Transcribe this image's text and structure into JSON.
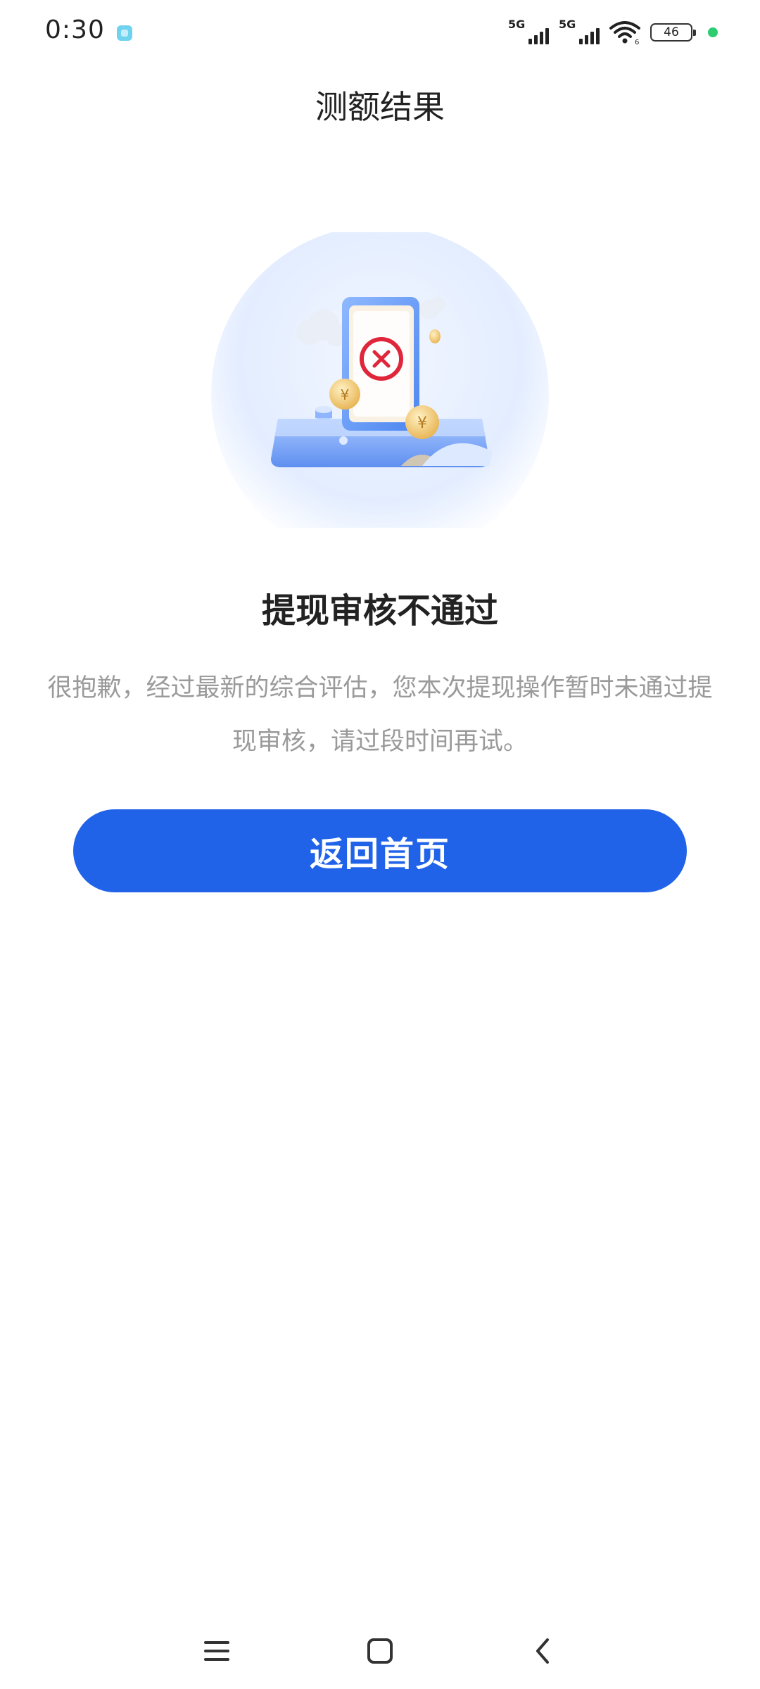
{
  "status_bar": {
    "time": "0:30",
    "signal_1_label": "5G",
    "signal_2_label": "5G",
    "battery": "46",
    "wifi_sub": "6"
  },
  "header": {
    "title": "测额结果"
  },
  "result": {
    "title": "提现审核不通过",
    "description": "很抱歉，经过最新的综合评估，您本次提现操作暂时未通过提现审核，请过段时间再试。"
  },
  "actions": {
    "home_label": "返回首页"
  },
  "icons": {
    "status_indicator": "green-dot-icon",
    "illustration": "rejected-phone-illustration",
    "nav_menu": "menu-icon",
    "nav_home": "home-square-icon",
    "nav_back": "back-chevron-icon"
  },
  "colors": {
    "primary": "#2163e8",
    "text_primary": "#222222",
    "text_secondary": "#9a9a9a",
    "error_red": "#e0263a",
    "indicator_green": "#2ecc71"
  }
}
